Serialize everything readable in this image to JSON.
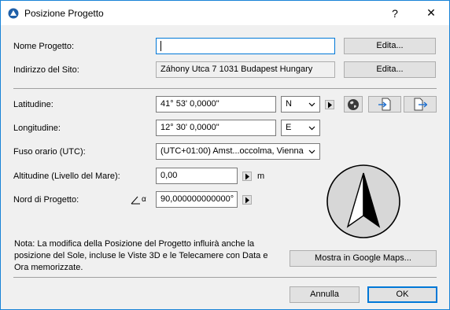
{
  "window": {
    "title": "Posizione Progetto",
    "help_label": "?",
    "close_label": "✕"
  },
  "project_name": {
    "label": "Nome Progetto:",
    "value": "",
    "edit_label": "Edita..."
  },
  "site_address": {
    "label": "Indirizzo del Sito:",
    "value": "Záhony Utca 7 1031 Budapest Hungary",
    "edit_label": "Edita..."
  },
  "latitude": {
    "label": "Latitudine:",
    "value": "41° 53' 0,0000\"",
    "direction": "N"
  },
  "longitude": {
    "label": "Longitudine:",
    "value": "12° 30' 0,0000\"",
    "direction": "E"
  },
  "timezone": {
    "label": "Fuso orario (UTC):",
    "value": "(UTC+01:00) Amst...occolma, Vienna"
  },
  "altitude": {
    "label": "Altitudine (Livello del Mare):",
    "value": "0,00",
    "unit": "m"
  },
  "project_north": {
    "label": "Nord di Progetto:",
    "value": "90,000000000000°",
    "angle_symbol": "α"
  },
  "icons": {
    "globe": "globe-icon",
    "import": "import-file-icon",
    "export": "export-file-icon",
    "compass": "compass-icon"
  },
  "note": "Nota: La modifica della Posizione del Progetto influirà anche la posizione del Sole, incluse le Viste 3D e le Telecamere con Data e Ora memorizzate.",
  "google_maps_label": "Mostra in Google Maps...",
  "footer": {
    "cancel_label": "Annulla",
    "ok_label": "OK"
  },
  "colors": {
    "accent": "#0078d7",
    "window_border": "#1883d7",
    "dialog_bg": "#f0f0f0"
  }
}
